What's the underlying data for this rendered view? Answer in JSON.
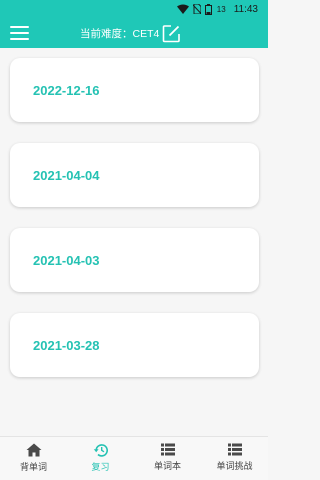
{
  "status_bar": {
    "battery_level": "13",
    "time": "11:43"
  },
  "header": {
    "difficulty_label": "当前难度：CET4",
    "menu_icon": "hamburger-menu-icon",
    "edit_icon": "edit-icon"
  },
  "review_dates": [
    "2022-12-16",
    "2021-04-04",
    "2021-04-03",
    "2021-03-28"
  ],
  "bottom_nav": {
    "items": [
      {
        "label": "背单词",
        "icon": "home-icon",
        "active": false
      },
      {
        "label": "复习",
        "icon": "history-clock-icon",
        "active": true
      },
      {
        "label": "单词本",
        "icon": "list-icon",
        "active": false
      },
      {
        "label": "单词挑战",
        "icon": "list-icon",
        "active": false
      }
    ]
  },
  "colors": {
    "accent": "#1fc8b7",
    "date_text": "#25c2b3",
    "background": "#f6f6f6"
  }
}
